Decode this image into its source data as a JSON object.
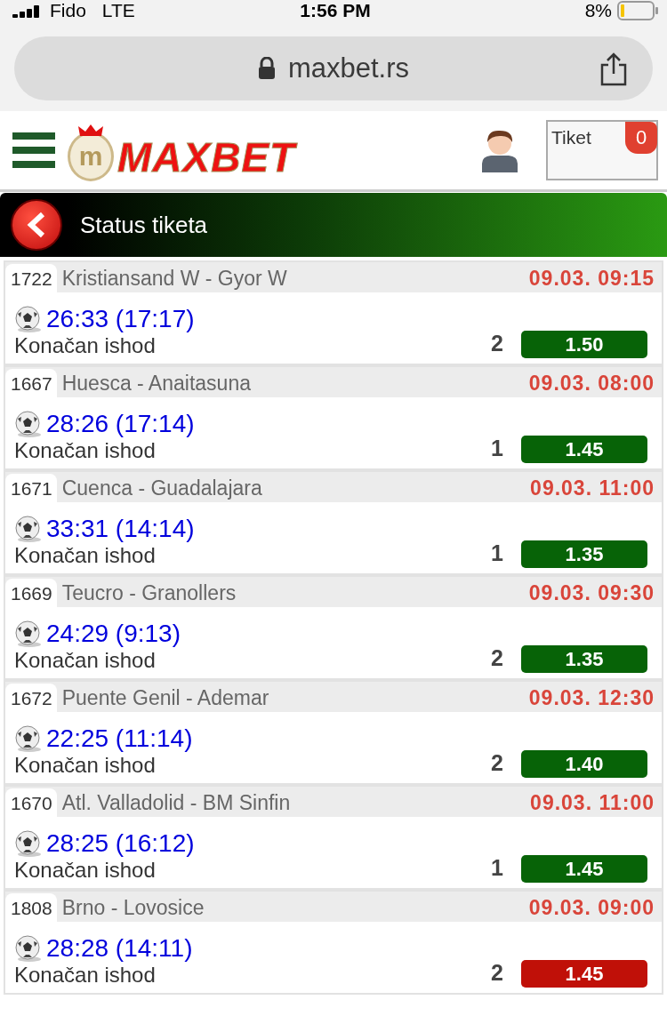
{
  "status_bar": {
    "carrier": "Fido",
    "network": "LTE",
    "time": "1:56 PM",
    "battery": "8%"
  },
  "browser": {
    "url": "maxbet.rs"
  },
  "header": {
    "logo_emblem": "m",
    "logo": "MAXBET",
    "ticket_label": "Tiket",
    "ticket_count": "0"
  },
  "title_bar": {
    "title": "Status tiketa"
  },
  "matches": [
    {
      "code": "1722",
      "teams": "Kristiansand W - Gyor W",
      "date": "09.03. 09:15",
      "score": "26:33 (17:17)",
      "market": "Konačan ishod",
      "pick": "2",
      "odds": "1.50",
      "won": true
    },
    {
      "code": "1667",
      "teams": "Huesca - Anaitasuna",
      "date": "09.03. 08:00",
      "score": "28:26 (17:14)",
      "market": "Konačan ishod",
      "pick": "1",
      "odds": "1.45",
      "won": true
    },
    {
      "code": "1671",
      "teams": "Cuenca - Guadalajara",
      "date": "09.03. 11:00",
      "score": "33:31 (14:14)",
      "market": "Konačan ishod",
      "pick": "1",
      "odds": "1.35",
      "won": true
    },
    {
      "code": "1669",
      "teams": "Teucro - Granollers",
      "date": "09.03. 09:30",
      "score": "24:29 (9:13)",
      "market": "Konačan ishod",
      "pick": "2",
      "odds": "1.35",
      "won": true
    },
    {
      "code": "1672",
      "teams": "Puente Genil - Ademar",
      "date": "09.03. 12:30",
      "score": "22:25 (11:14)",
      "market": "Konačan ishod",
      "pick": "2",
      "odds": "1.40",
      "won": true
    },
    {
      "code": "1670",
      "teams": "Atl. Valladolid - BM Sinfin",
      "date": "09.03. 11:00",
      "score": "28:25 (16:12)",
      "market": "Konačan ishod",
      "pick": "1",
      "odds": "1.45",
      "won": true
    },
    {
      "code": "1808",
      "teams": "Brno - Lovosice",
      "date": "09.03. 09:00",
      "score": "28:28 (14:11)",
      "market": "Konačan ishod",
      "pick": "2",
      "odds": "1.45",
      "won": false
    }
  ]
}
